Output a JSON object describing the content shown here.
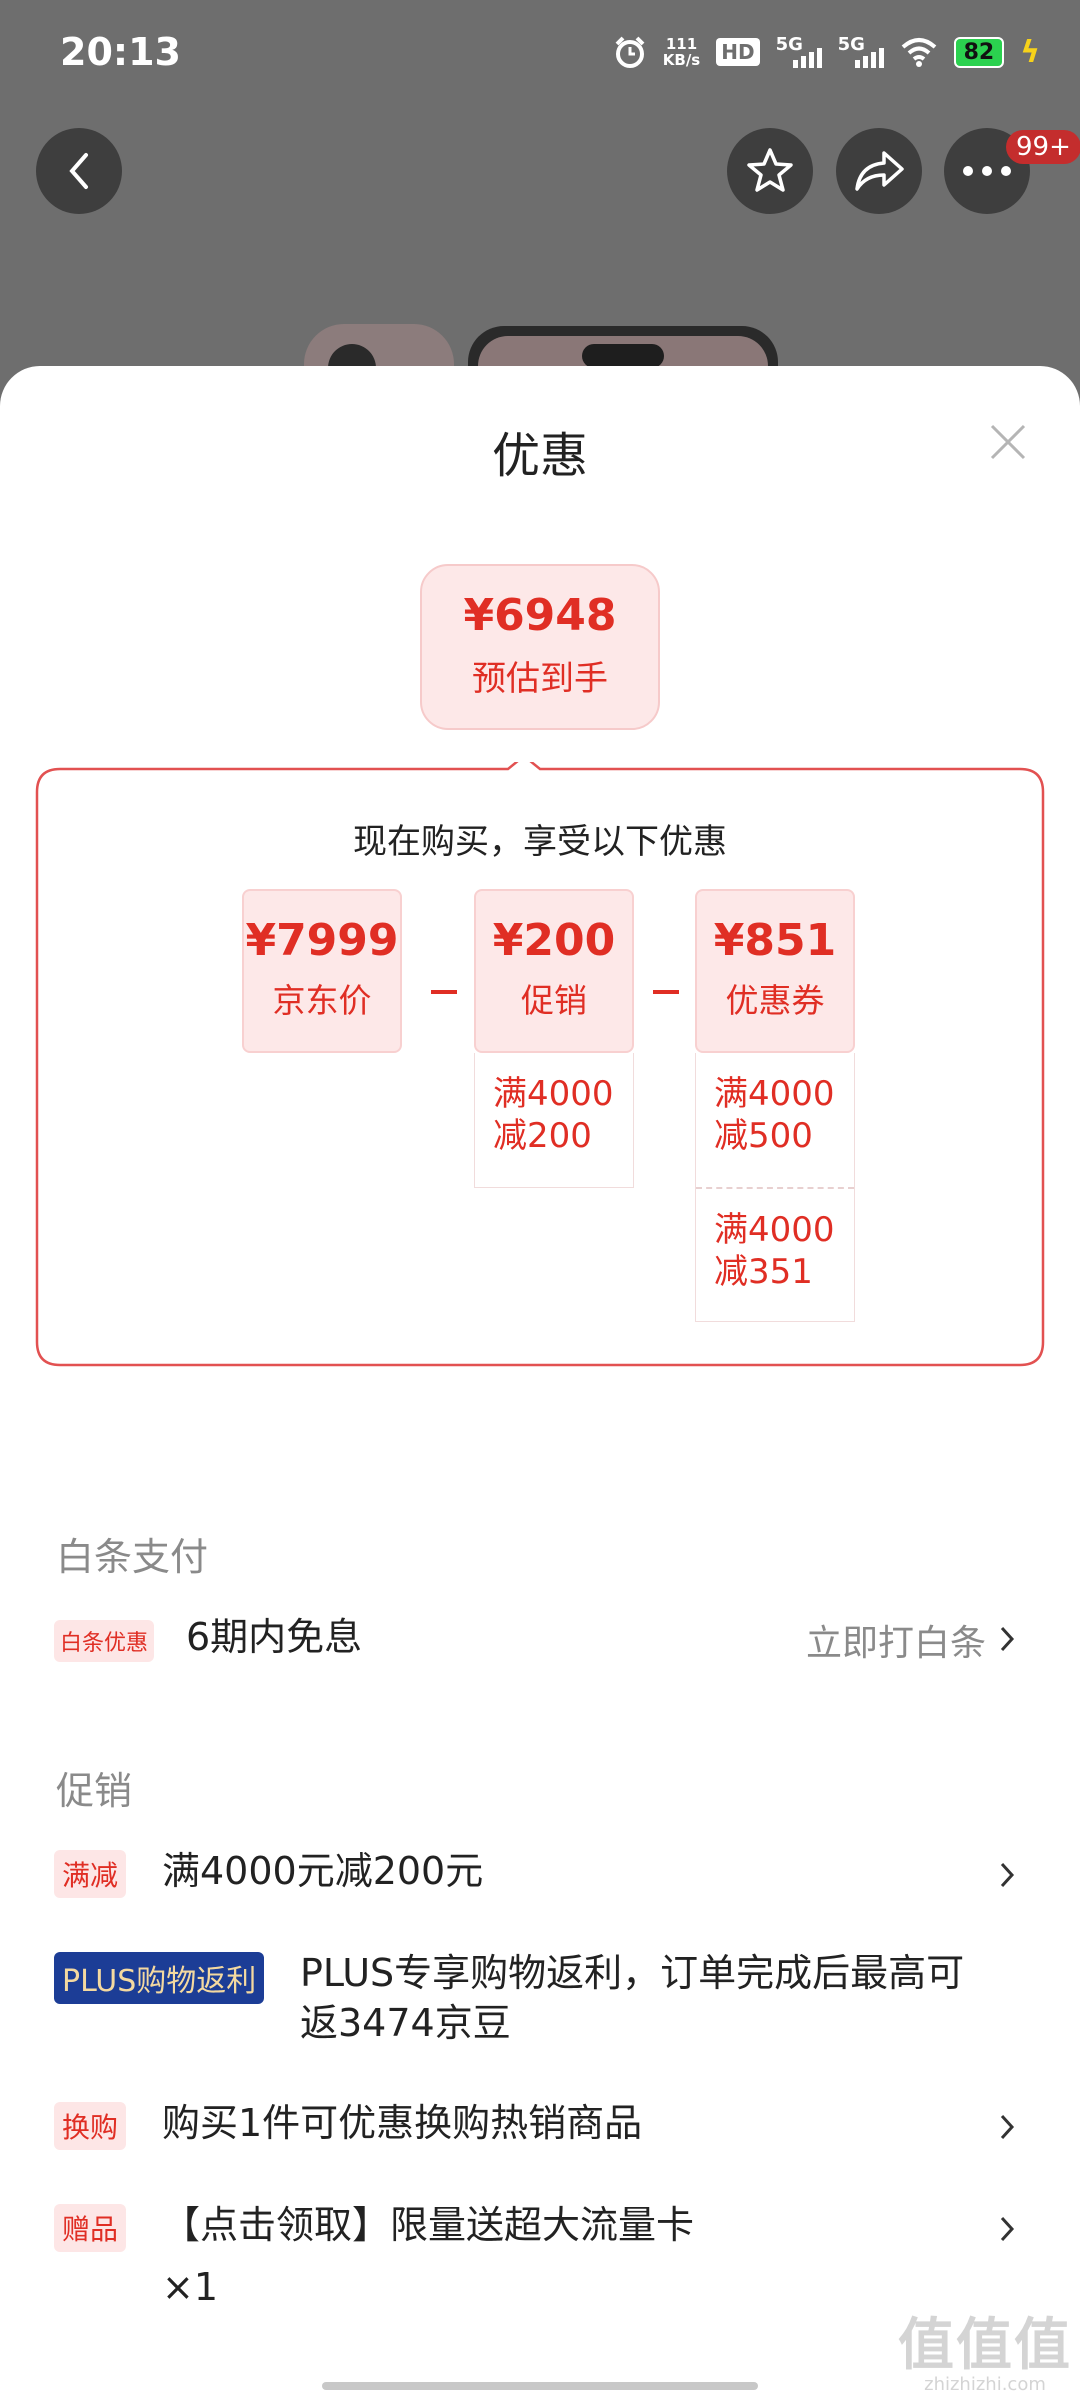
{
  "status_bar": {
    "time": "20:13",
    "net_speed_value": "111",
    "net_speed_unit": "KB/s",
    "hd_label": "HD",
    "sim1_label": "5G",
    "sim2_label": "5G",
    "battery": "82"
  },
  "header": {
    "notification_badge": "99+"
  },
  "sheet": {
    "title": "优惠",
    "estimate": {
      "price": "¥6948",
      "label": "预估到手"
    },
    "breakdown": {
      "heading": "现在购买，享受以下优惠",
      "items": [
        {
          "price": "¥7999",
          "label": "京东价",
          "conditions": []
        },
        {
          "price": "¥200",
          "label": "促销",
          "conditions": [
            "满4000\n减200"
          ]
        },
        {
          "price": "¥851",
          "label": "优惠券",
          "conditions": [
            "满4000\n减500",
            "满4000\n减351"
          ]
        }
      ]
    }
  },
  "baitiao": {
    "section_title": "白条支付",
    "tag": "白条优惠",
    "text": "6期内免息",
    "action": "立即打白条"
  },
  "promotions": {
    "section_title": "促销",
    "items": [
      {
        "tag": "满减",
        "text": "满4000元减200元"
      },
      {
        "tag": "PLUS购物返利",
        "text_line1": "PLUS专享购物返利，订单完成后最高可",
        "text_line2": "返3474京豆"
      },
      {
        "tag": "换购",
        "text": "购买1件可优惠换购热销商品"
      },
      {
        "tag": "赠品",
        "text": "【点击领取】限量送超大流量卡",
        "quantity": "×1"
      }
    ]
  },
  "watermark": {
    "logo": "值值值",
    "url": "zhizhizhi.com"
  },
  "colors": {
    "accent": "#e02e24",
    "tag_bg": "#fde6e6",
    "plus_bg": "#1c3d96",
    "plus_fg": "#f4d9a0",
    "overlay": "#6e6e6e"
  }
}
